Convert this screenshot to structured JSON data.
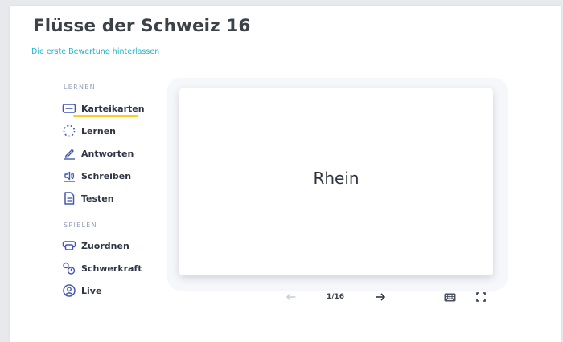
{
  "title": "Flüsse der Schweiz 16",
  "rate_link": "Die erste Bewertung hinterlassen",
  "sections": {
    "learn": {
      "label": "LERNEN",
      "items": [
        {
          "label": "Karteikarten",
          "icon": "flashcards-icon",
          "active": true
        },
        {
          "label": "Lernen",
          "icon": "learn-cycle-icon"
        },
        {
          "label": "Antworten",
          "icon": "write-pencil-icon"
        },
        {
          "label": "Schreiben",
          "icon": "speaker-icon"
        },
        {
          "label": "Testen",
          "icon": "test-document-icon"
        }
      ]
    },
    "play": {
      "label": "SPIELEN",
      "items": [
        {
          "label": "Zuordnen",
          "icon": "match-icon"
        },
        {
          "label": "Schwerkraft",
          "icon": "gravity-icon"
        },
        {
          "label": "Live",
          "icon": "live-icon"
        }
      ]
    }
  },
  "flashcard": {
    "term": "Rhein"
  },
  "controls": {
    "counter": "1/16",
    "prev_icon": "arrow-left-icon",
    "next_icon": "arrow-right-icon",
    "keyboard_icon": "keyboard-icon",
    "fullscreen_icon": "fullscreen-icon"
  },
  "colors": {
    "accent_link": "#1fb4c9",
    "active_underline": "#ffcd1f",
    "icon_blue": "#4257b2"
  }
}
